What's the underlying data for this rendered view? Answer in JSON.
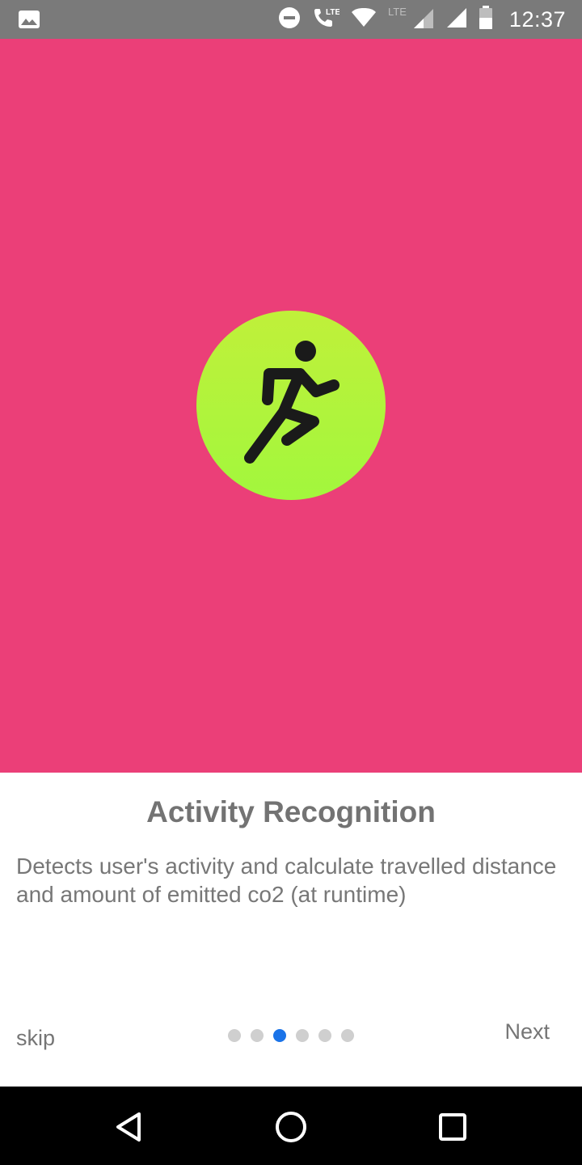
{
  "status_bar": {
    "time": "12:37",
    "icons": [
      "gallery-icon",
      "do-not-disturb-icon",
      "volte-call-icon",
      "wifi-icon",
      "lte-signal-icon",
      "signal-icon",
      "battery-icon"
    ],
    "lte_label": "LTE",
    "call_lte_label": "LTE"
  },
  "hero": {
    "background_color": "#eb3f78",
    "circle_color": "#b4f23b",
    "icon": "running-person-icon"
  },
  "onboarding": {
    "title": "Activity Recognition",
    "description": "Detects user's activity and calculate travelled distance and amount of emitted co2 (at runtime)",
    "page_count": 6,
    "active_page": 3,
    "skip_label": "skip",
    "next_label": "Next",
    "active_dot_color": "#1a73e8"
  },
  "nav_bar": {
    "buttons": [
      "back-icon",
      "home-icon",
      "recents-icon"
    ]
  }
}
